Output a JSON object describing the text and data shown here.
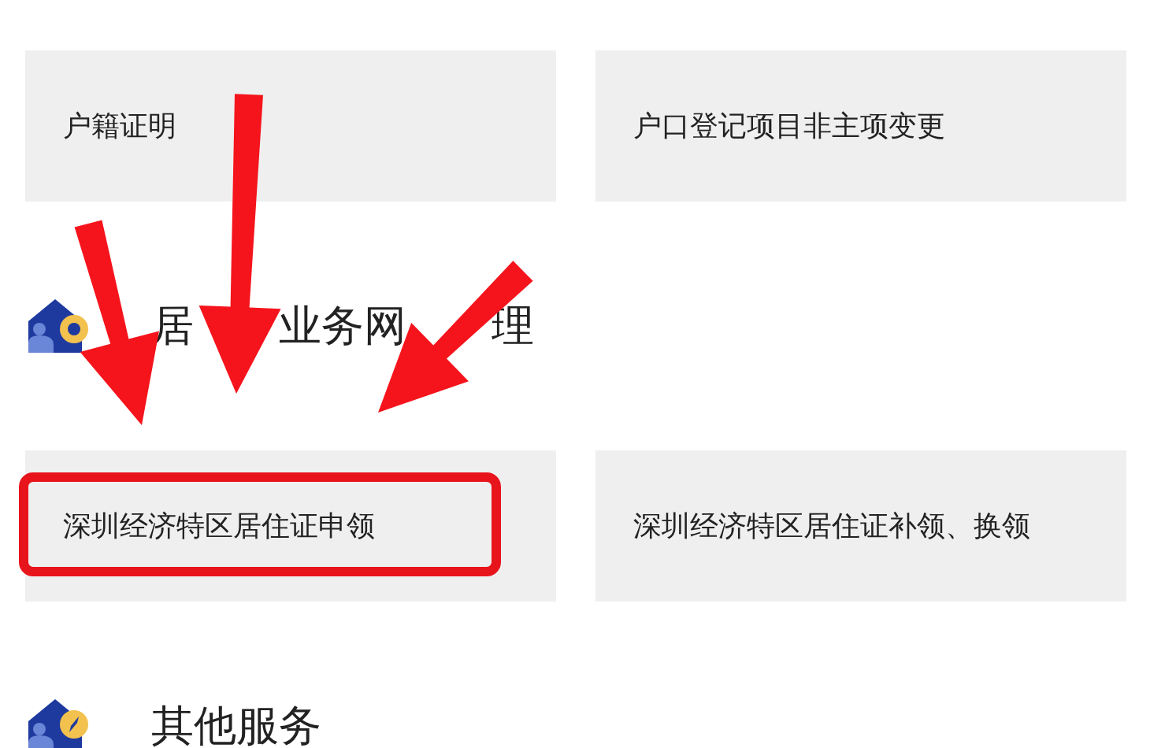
{
  "sections": [
    {
      "cards": [
        {
          "label": "户籍证明",
          "highlighted": false
        },
        {
          "label": "户口登记项目非主项变更",
          "highlighted": false
        }
      ]
    },
    {
      "title_parts": [
        "居",
        "业务网",
        "理"
      ],
      "cards": [
        {
          "label": "深圳经济特区居住证申领",
          "highlighted": true
        },
        {
          "label": "深圳经济特区居住证补领、换领",
          "highlighted": false
        }
      ]
    },
    {
      "title_parts": [
        "其他服务"
      ]
    }
  ]
}
